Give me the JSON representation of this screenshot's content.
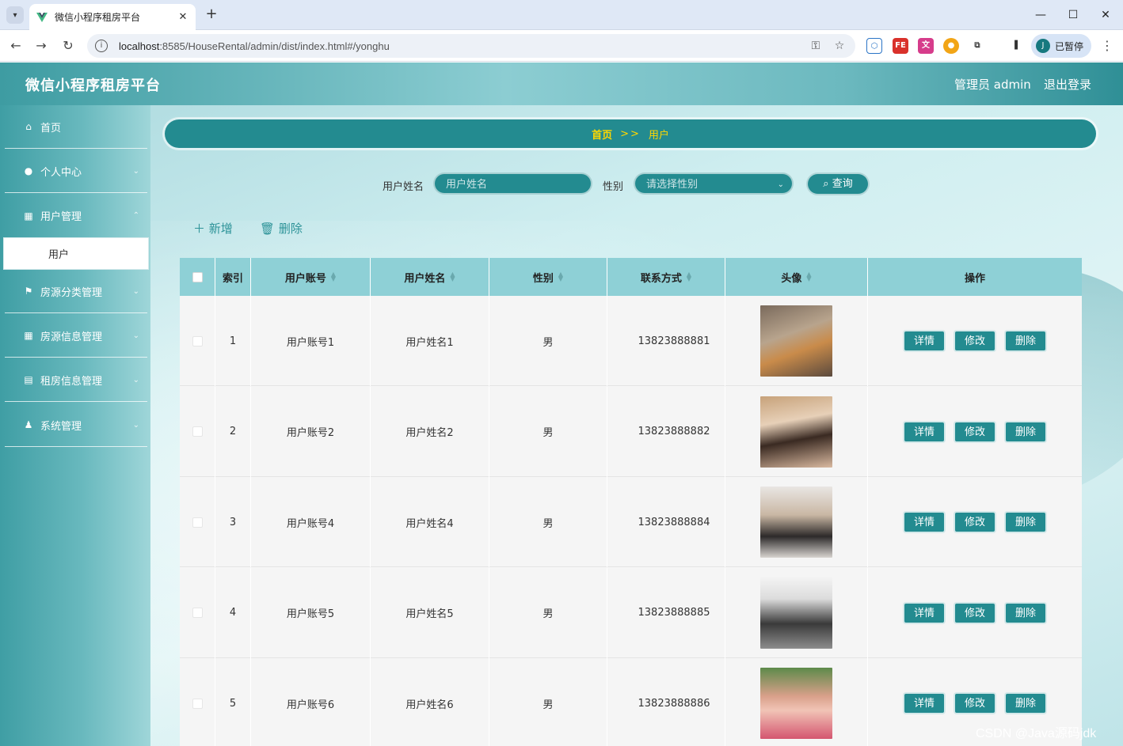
{
  "browser": {
    "tab_title": "微信小程序租房平台",
    "url_host": "localhost",
    "url_path": ":8585/HouseRental/admin/dist/index.html#/yonghu",
    "profile_initial": "J",
    "profile_status": "已暂停"
  },
  "header": {
    "brand": "微信小程序租房平台",
    "admin_label": "管理员 admin",
    "logout": "退出登录"
  },
  "sidebar": {
    "items": [
      {
        "label": "首页",
        "icon": "home-icon"
      },
      {
        "label": "个人中心",
        "icon": "user-icon"
      },
      {
        "label": "用户管理",
        "icon": "grid-icon"
      },
      {
        "label": "房源分类管理",
        "icon": "flag-icon"
      },
      {
        "label": "房源信息管理",
        "icon": "grid-icon"
      },
      {
        "label": "租房信息管理",
        "icon": "clipboard-icon"
      },
      {
        "label": "系统管理",
        "icon": "stamp-icon"
      }
    ],
    "active_sub": "用户"
  },
  "breadcrumb": {
    "home": "首页",
    "sep": ">>",
    "current": "用户"
  },
  "search": {
    "name_label": "用户姓名",
    "name_placeholder": "用户姓名",
    "gender_label": "性别",
    "gender_placeholder": "请选择性别",
    "query_button": "查询"
  },
  "actions": {
    "add": "新增",
    "delete": "删除"
  },
  "table": {
    "columns": [
      "索引",
      "用户账号",
      "用户姓名",
      "性别",
      "联系方式",
      "头像",
      "操作"
    ],
    "rows": [
      {
        "index": "1",
        "account": "用户账号1",
        "name": "用户姓名1",
        "gender": "男",
        "phone": "13823888881"
      },
      {
        "index": "2",
        "account": "用户账号2",
        "name": "用户姓名2",
        "gender": "男",
        "phone": "13823888882"
      },
      {
        "index": "3",
        "account": "用户账号4",
        "name": "用户姓名4",
        "gender": "男",
        "phone": "13823888884"
      },
      {
        "index": "4",
        "account": "用户账号5",
        "name": "用户姓名5",
        "gender": "男",
        "phone": "13823888885"
      },
      {
        "index": "5",
        "account": "用户账号6",
        "name": "用户姓名6",
        "gender": "男",
        "phone": "13823888886"
      }
    ],
    "row_buttons": {
      "detail": "详情",
      "edit": "修改",
      "remove": "删除"
    }
  },
  "watermark": "CSDN @Java源码jdk",
  "colors": {
    "primary": "#238b90",
    "header_head": "#8ed0d6",
    "crumb_text": "#ffd700"
  }
}
